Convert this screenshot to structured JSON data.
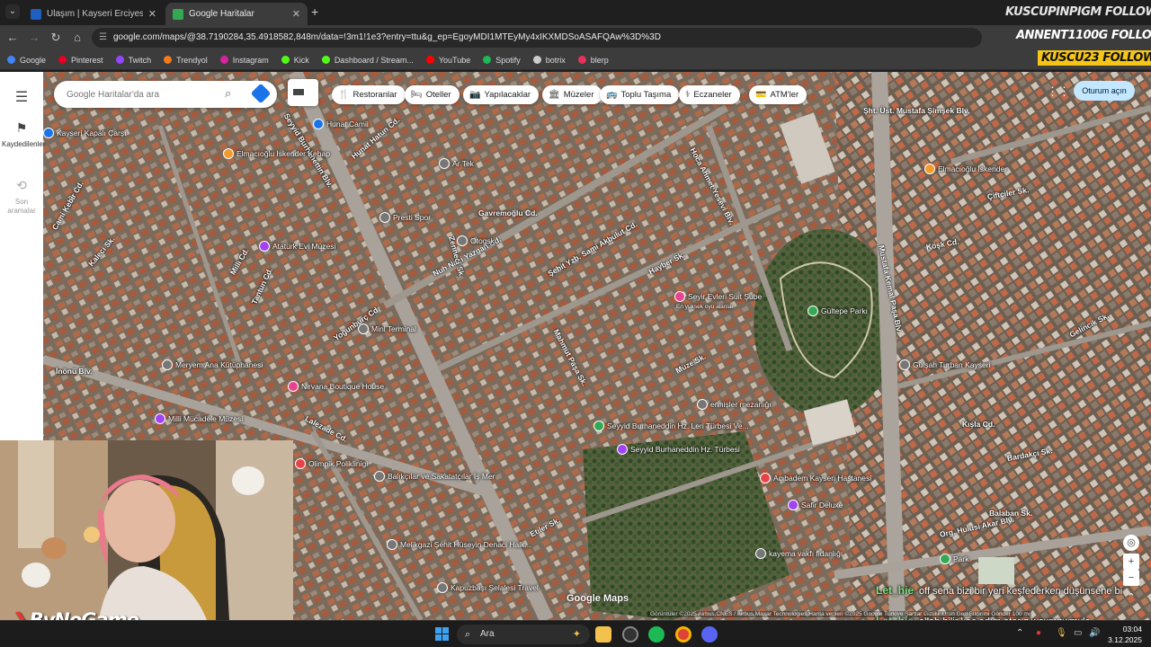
{
  "browser": {
    "tabs": [
      {
        "title": "Ulaşım | Kayseri Erciyes Kayak M",
        "active": false,
        "favicon_color": "#1e5fbf"
      },
      {
        "title": "Google Haritalar",
        "active": true,
        "favicon_color": "#34a853"
      }
    ],
    "new_tab_icon": "plus-icon",
    "url": "google.com/maps/@38.7190284,35.4918582,848m/data=!3m1!1e3?entry=ttu&g_ep=EgoyMDI1MTEyMy4xIKXMDSoASAFQAw%3D%3D",
    "bookmarks": [
      {
        "label": "Google",
        "color": "#4285f4"
      },
      {
        "label": "Pinterest",
        "color": "#e60023"
      },
      {
        "label": "Twitch",
        "color": "#9146ff"
      },
      {
        "label": "Trendyol",
        "color": "#f27a1a"
      },
      {
        "label": "Instagram",
        "color": "#d6249f"
      },
      {
        "label": "Kick",
        "color": "#53fc18"
      },
      {
        "label": "Dashboard / Stream...",
        "color": "#53fc18"
      },
      {
        "label": "YouTube",
        "color": "#ff0000"
      },
      {
        "label": "Spotify",
        "color": "#1db954"
      },
      {
        "label": "botrix",
        "color": "#cccccc"
      },
      {
        "label": "blerp",
        "color": "#e8315b"
      }
    ]
  },
  "maps": {
    "search_placeholder": "Google Haritalar'da ara",
    "rail": {
      "saved_label": "Kaydedilenler",
      "recent_label": "Son aramalar"
    },
    "chips": [
      {
        "label": "Restoranlar",
        "icon": "fork-knife-icon"
      },
      {
        "label": "Oteller",
        "icon": "bed-icon"
      },
      {
        "label": "Yapılacaklar",
        "icon": "camera-icon"
      },
      {
        "label": "Müzeler",
        "icon": "museum-icon"
      },
      {
        "label": "Toplu Taşıma",
        "icon": "bus-icon"
      },
      {
        "label": "Eczaneler",
        "icon": "pharmacy-icon"
      },
      {
        "label": "ATM'ler",
        "icon": "atm-icon"
      }
    ],
    "signin_label": "Oturum açın",
    "logo_text": "Google Maps",
    "attribution": "Görüntüler ©2025 Airbus,CNES / Airbus,Maxar Technologies,Harita verileri ©2025 Google   Türkiye   Şartlar   Gizlilik   Ürün Geri Bildirimi Gönder   100 m",
    "road_labels": [
      {
        "text": "Şht. Üst. Mustafa Şimşek Blv."
      },
      {
        "text": "Hunat Hatun Cd."
      },
      {
        "text": "Seyyid Burhanettin Blv."
      },
      {
        "text": "Gavremoğlu Cd."
      },
      {
        "text": "Nuh Naci Yazgan Cd."
      },
      {
        "text": "Şehit Yzb. Sami Akbulut Cd."
      },
      {
        "text": "Hoca Ahmet Yesevi Blv."
      },
      {
        "text": "Mustafa Kemal Paşa Blv."
      },
      {
        "text": "Hayber Sk."
      },
      {
        "text": "Mahmut Paşa Sk."
      },
      {
        "text": "Müze Sk."
      },
      {
        "text": "İnönü Blv."
      },
      {
        "text": "Yoğunburç Cd."
      },
      {
        "text": "Lalezade Cd."
      },
      {
        "text": "Etiler Sk."
      },
      {
        "text": "Org. Hulusi Akar Blv."
      },
      {
        "text": "Gelincik Sk."
      },
      {
        "text": "Köşk Cd."
      },
      {
        "text": "Çiftçiler Sk."
      },
      {
        "text": "Kışla Cd."
      },
      {
        "text": "Bardakçı Sk."
      },
      {
        "text": "Balaban Sk."
      },
      {
        "text": "Zenneci Sk."
      },
      {
        "text": "Kaleci Sk."
      },
      {
        "text": "Milli Cd."
      },
      {
        "text": "Tantun Cd."
      },
      {
        "text": "Cami Kebir Cd."
      }
    ],
    "pois": [
      {
        "text": "Hunat Camii",
        "color": "#1a73e8"
      },
      {
        "text": "Kayseri Kapalı Çarşı",
        "color": "#1a73e8"
      },
      {
        "text": "Elmacıoğlu İskender Kebap",
        "color": "#f29b2c"
      },
      {
        "text": "Ar Tek",
        "color": "#777777"
      },
      {
        "text": "Presti Spor",
        "color": "#777777"
      },
      {
        "text": "Otogsk",
        "color": "#777777"
      },
      {
        "text": "Atatürk Evi Müzesi",
        "color": "#a142f4"
      },
      {
        "text": "Mini Terminal",
        "color": "#777777"
      },
      {
        "text": "Meryem Ana Kütüphanesi",
        "color": "#777777"
      },
      {
        "text": "Nirvana Boutique House",
        "color": "#e8438c"
      },
      {
        "text": "Milli Mücadele Müzesi",
        "color": "#a142f4"
      },
      {
        "text": "Seyir Evleri Suit Şube",
        "color": "#e8438c"
      },
      {
        "text": "En yüksek oyu alanlar",
        "color": ""
      },
      {
        "text": "Gültepe Parkı",
        "color": "#34a853"
      },
      {
        "text": "Elmacıoğlu İskender",
        "color": "#f29b2c"
      },
      {
        "text": "Gülşah Turban Kayseri",
        "color": "#777777"
      },
      {
        "text": "Seyyid Burhaneddin Hz. Leri Türbesi Ve...",
        "color": "#34a853"
      },
      {
        "text": "Seyyid Burhaneddin Hz. Türbesi",
        "color": "#a142f4"
      },
      {
        "text": "ermişler mezarlığı",
        "color": "#777777"
      },
      {
        "text": "Acıbadem Kayseri Hastanesi",
        "color": "#e8434b"
      },
      {
        "text": "Safir Deluxe",
        "color": "#a142f4"
      },
      {
        "text": "Balıkçılar ve Sakatatçılar İş Mer",
        "color": "#777777"
      },
      {
        "text": "Melikgazi Şehit Hüseyin Denaci Halk...",
        "color": "#777777"
      },
      {
        "text": "Kapuzbaşı Şelalesi Travel",
        "color": "#777777"
      },
      {
        "text": "kayema vakfı fidanlığı",
        "color": "#777777"
      },
      {
        "text": "Park",
        "color": "#34a853"
      },
      {
        "text": "Olimpik Poliklinigi",
        "color": "#e8434b"
      }
    ]
  },
  "overlay": {
    "follow_lines": [
      "KUSCUPINPIGM FOLLOW",
      "ANNENT1100G FOLLOW",
      "KUSCU23 FOLLOW"
    ],
    "brand": "ByNoGame",
    "chat": [
      {
        "user": "Let_hie",
        "message": "off sena bizi bir yeri keşfederken düşünsene bi"
      },
      {
        "user": "Let_hie",
        "message": "allah bilir kaç adım atarız woxmpwmxls"
      }
    ]
  },
  "taskbar": {
    "search_placeholder": "Ara",
    "time": "03:04",
    "date": "3.12.2025"
  }
}
